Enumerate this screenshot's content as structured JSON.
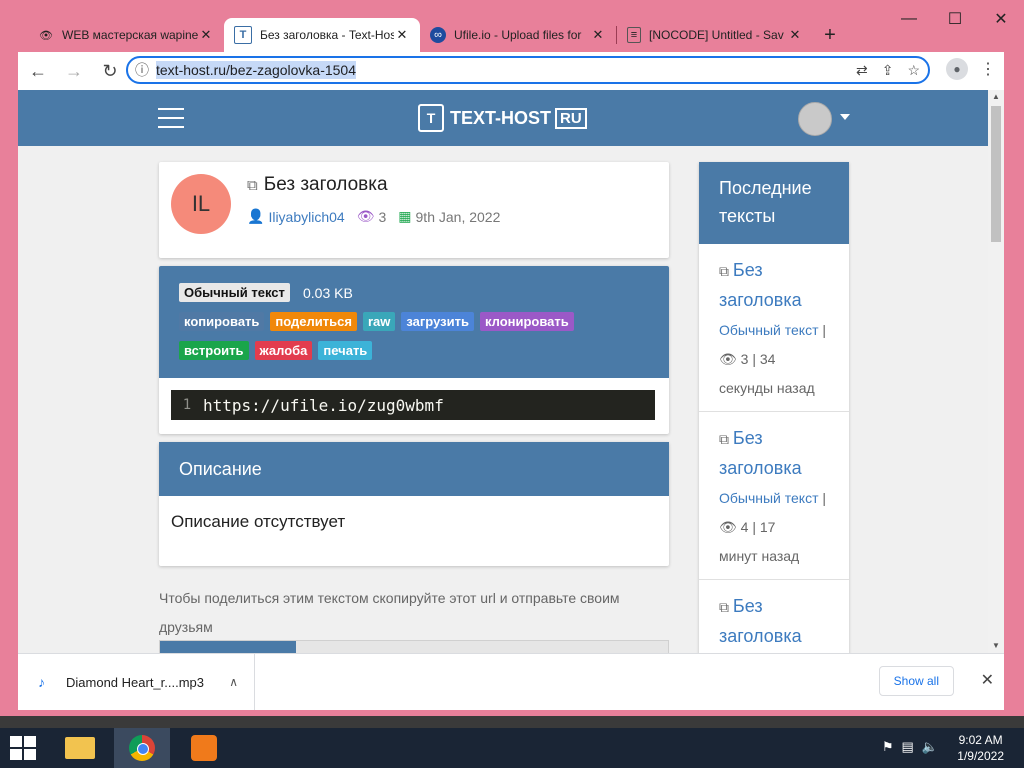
{
  "browser": {
    "tabs": [
      {
        "title": "WEB мастерская wapinet",
        "icon": "eye-favicon",
        "active": false
      },
      {
        "title": "Без заголовка - Text-Host",
        "icon": "text-host-favicon",
        "active": true
      },
      {
        "title": "Ufile.io - Upload files for",
        "icon": "ufile-favicon",
        "active": false
      },
      {
        "title": "[NOCODE] Untitled - Sav",
        "icon": "page-favicon",
        "active": false
      }
    ],
    "url": "text-host.ru/bez-zagolovka-1504",
    "window_controls": {
      "minimize": "—",
      "maximize": "☐",
      "close": "✕"
    }
  },
  "site": {
    "logo_text": "TEXT-HOST",
    "logo_suffix": "RU",
    "logo_mark": "T"
  },
  "post": {
    "avatar_initials": "IL",
    "title": "Без заголовка",
    "author": "Iliyabylich04",
    "views": "3",
    "date": "9th Jan, 2022",
    "type_badge": "Обычный текст",
    "size": "0.03 KB",
    "actions_row1": [
      {
        "label": "копировать",
        "color": "#5079a5"
      },
      {
        "label": "поделиться",
        "color": "#f0880a"
      },
      {
        "label": "raw",
        "color": "#3aa7b9"
      },
      {
        "label": "загрузить",
        "color": "#4c84d8"
      },
      {
        "label": "клонировать",
        "color": "#9b59c7"
      }
    ],
    "actions_row2": [
      {
        "label": "встроить",
        "color": "#1aa54b"
      },
      {
        "label": "жалоба",
        "color": "#e23c4e"
      },
      {
        "label": "печать",
        "color": "#3cb3d8"
      }
    ],
    "code_line_no": "1",
    "code": "https://ufile.io/zug0wbmf"
  },
  "description": {
    "heading": "Описание",
    "body": "Описание отсутствует"
  },
  "share": {
    "text": "Чтобы поделиться этим текстом скопируйте этот url и отправьте своим друзьям"
  },
  "sidebar": {
    "heading": "Последние тексты",
    "items": [
      {
        "title": "Без заголовка",
        "category": "Обычный текст",
        "sep": "|",
        "views": "3",
        "chars": "34",
        "time": "секунды назад"
      },
      {
        "title": "Без заголовка",
        "category": "Обычный текст",
        "sep": "|",
        "views": "4",
        "chars": "17",
        "time": "минут назад"
      },
      {
        "title": "Без заголовка"
      }
    ]
  },
  "downloads": {
    "file": "Diamond Heart_r....mp3",
    "show_all": "Show all"
  },
  "taskbar": {
    "time": "9:02 AM",
    "date": "1/9/2022"
  },
  "colors": {
    "header_blue": "#4a7aa7",
    "link_blue": "#3d7bbf",
    "frame_pink": "#e8809a",
    "avatar_salmon": "#f58a7a"
  }
}
